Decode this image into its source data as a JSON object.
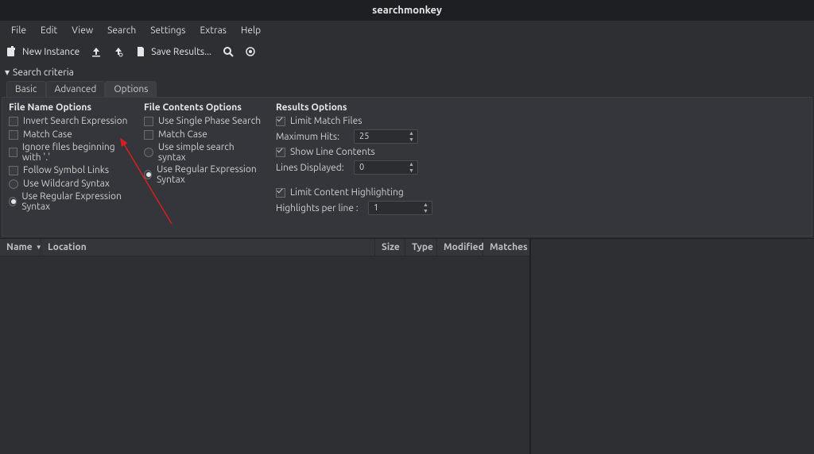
{
  "app": {
    "title": "searchmonkey"
  },
  "menu": {
    "file": "File",
    "edit": "Edit",
    "view": "View",
    "search": "Search",
    "settings": "Settings",
    "extras": "Extras",
    "help": "Help"
  },
  "toolbar": {
    "new_instance": "New Instance",
    "save_results": "Save Results..."
  },
  "criteria": {
    "header": "Search criteria",
    "tabs": {
      "basic": "Basic",
      "advanced": "Advanced",
      "options": "Options"
    }
  },
  "file_name_options": {
    "title": "File Name Options",
    "invert": "Invert Search Expression",
    "match_case": "Match Case",
    "ignore_dot": "Ignore files beginning with '.'",
    "follow_symlinks": "Follow Symbol Links",
    "wildcard": "Use Wildcard Syntax",
    "regex": "Use Regular Expression Syntax"
  },
  "file_contents_options": {
    "title": "File Contents Options",
    "single_phase": "Use Single Phase Search",
    "match_case": "Match Case",
    "simple": "Use simple search syntax",
    "regex": "Use Regular Expression Syntax"
  },
  "results_options": {
    "title": "Results Options",
    "limit_match": "Limit Match Files",
    "max_hits_label": "Maximum Hits:",
    "max_hits_value": "25",
    "show_line": "Show Line Contents",
    "lines_displayed_label": "Lines Displayed:",
    "lines_displayed_value": "0",
    "limit_highlight": "Limit Content Highlighting",
    "highlights_label": "Highlights per line :",
    "highlights_value": "1"
  },
  "columns": {
    "name": "Name",
    "location": "Location",
    "size": "Size",
    "type": "Type",
    "modified": "Modified",
    "matches": "Matches"
  }
}
